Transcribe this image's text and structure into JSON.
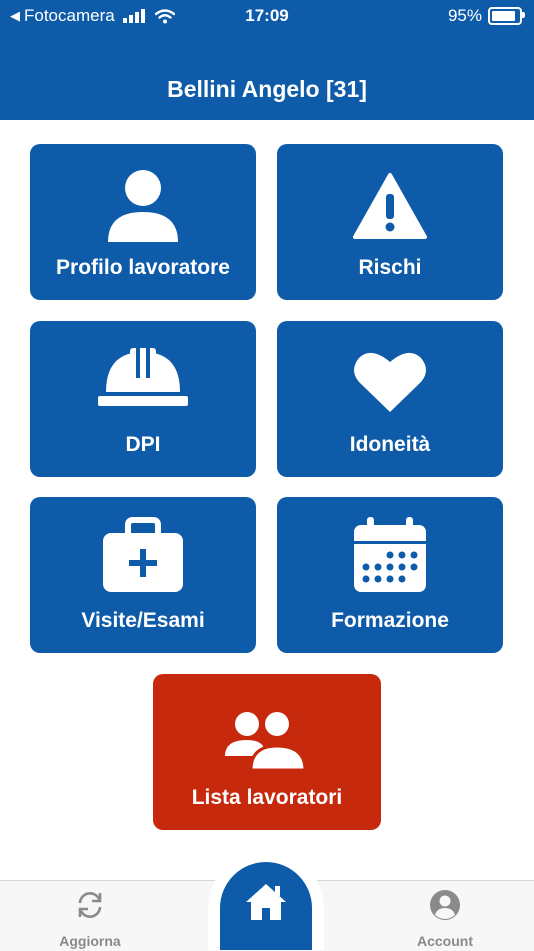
{
  "status_bar": {
    "back_app": "Fotocamera",
    "time": "17:09",
    "battery_percent": "95%",
    "battery_level": 0.95
  },
  "header": {
    "title": "Bellini Angelo [31]"
  },
  "tiles": [
    {
      "label": "Profilo lavoratore",
      "icon": "user-icon"
    },
    {
      "label": "Rischi",
      "icon": "warning-icon"
    },
    {
      "label": "DPI",
      "icon": "hard-hat-icon"
    },
    {
      "label": "Idoneità",
      "icon": "heart-icon"
    },
    {
      "label": "Visite/Esami",
      "icon": "medical-kit-icon"
    },
    {
      "label": "Formazione",
      "icon": "calendar-icon"
    },
    {
      "label": "Lista lavoratori",
      "icon": "users-icon"
    }
  ],
  "tabbar": {
    "left": {
      "label": "Aggiorna",
      "icon": "refresh-icon"
    },
    "center": {
      "icon": "home-icon"
    },
    "right": {
      "label": "Account",
      "icon": "account-icon"
    }
  },
  "colors": {
    "primary": "#0e5ba9",
    "accent_red": "#c7290c",
    "tab_inactive": "#8a8a8a"
  }
}
